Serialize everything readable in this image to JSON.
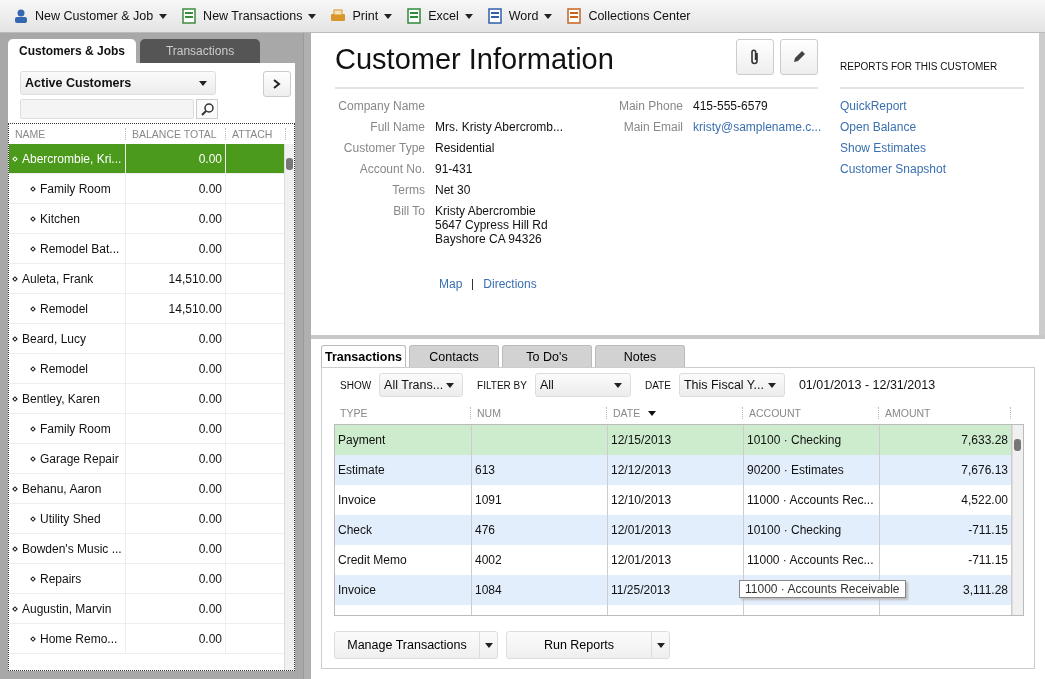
{
  "toolbar": [
    {
      "label": "New Customer & Job",
      "kind": "dropdown"
    },
    {
      "label": "New Transactions",
      "kind": "dropdown"
    },
    {
      "label": "Print",
      "kind": "dropdown"
    },
    {
      "label": "Excel",
      "kind": "dropdown"
    },
    {
      "label": "Word",
      "kind": "dropdown"
    },
    {
      "label": "Collections Center",
      "kind": "button"
    }
  ],
  "center": {
    "tabs": [
      {
        "label": "Customers & Jobs",
        "selected": true
      },
      {
        "label": "Transactions",
        "selected": false
      }
    ],
    "view_filter": "Active Customers",
    "columns": [
      "NAME",
      "BALANCE TOTAL",
      "ATTACH"
    ],
    "customers": [
      {
        "name": "Abercrombie, Kri...",
        "balance": "0.00",
        "selected": true,
        "children": [
          {
            "name": "Family Room",
            "balance": "0.00",
            "selected": false
          },
          {
            "name": "Kitchen",
            "balance": "0.00",
            "selected": false
          },
          {
            "name": "Remodel Bat...",
            "balance": "0.00",
            "selected": false
          }
        ]
      },
      {
        "name": "Auleta, Frank",
        "balance": "14,510.00",
        "selected": false,
        "children": [
          {
            "name": "Remodel",
            "balance": "14,510.00",
            "selected": false
          }
        ]
      },
      {
        "name": "Beard, Lucy",
        "balance": "0.00",
        "selected": false,
        "children": [
          {
            "name": "Remodel",
            "balance": "0.00",
            "selected": false
          }
        ]
      },
      {
        "name": "Bentley, Karen",
        "balance": "0.00",
        "selected": false,
        "children": [
          {
            "name": "Family Room",
            "balance": "0.00",
            "selected": false
          },
          {
            "name": "Garage Repair",
            "balance": "0.00",
            "selected": false
          }
        ]
      },
      {
        "name": "Behanu, Aaron",
        "balance": "0.00",
        "selected": false,
        "children": [
          {
            "name": "Utility Shed",
            "balance": "0.00",
            "selected": false
          }
        ]
      },
      {
        "name": "Bowden's Music ...",
        "balance": "0.00",
        "selected": false,
        "children": [
          {
            "name": "Repairs",
            "balance": "0.00",
            "selected": false
          }
        ]
      },
      {
        "name": "Augustin, Marvin",
        "balance": "0.00",
        "selected": false,
        "children": [
          {
            "name": "Home Remo...",
            "balance": "0.00",
            "selected": false
          }
        ]
      }
    ]
  },
  "customer_info": {
    "title": "Customer Information",
    "fields_left": [
      {
        "label": "Company Name"
      },
      {
        "label": "Full Name",
        "value": [
          "Mrs. Kristy Abercromb..."
        ]
      },
      {
        "label": "Customer Type",
        "value": [
          "Residential"
        ]
      },
      {
        "label": "Account No.",
        "value": [
          "91-431"
        ]
      },
      {
        "label": "Terms",
        "value": [
          "Net 30"
        ]
      },
      {
        "label": "Bill To",
        "value": [
          "Kristy Abercrombie",
          "5647 Cypress Hill Rd",
          "Bayshore CA 94326"
        ]
      }
    ],
    "fields_right": [
      {
        "label": "Main Phone",
        "value": "415-555-6579",
        "kind": "text"
      },
      {
        "label": "Main Email",
        "value": "kristy@samplename.c...",
        "kind": "link"
      }
    ],
    "map_links": [
      "Map",
      "Directions"
    ],
    "reports_heading": "REPORTS FOR THIS CUSTOMER",
    "reports": [
      "QuickReport",
      "Open Balance",
      "Show Estimates",
      "Customer Snapshot"
    ]
  },
  "details": {
    "tabs": [
      {
        "label": "Transactions",
        "selected": true
      },
      {
        "label": "Contacts",
        "selected": false
      },
      {
        "label": "To Do's",
        "selected": false
      },
      {
        "label": "Notes",
        "selected": false
      }
    ],
    "filters": [
      {
        "label": "SHOW",
        "value": "All Trans..."
      },
      {
        "label": "FILTER BY",
        "value": "All"
      },
      {
        "label": "DATE",
        "value": "This Fiscal Y..."
      }
    ],
    "date_range": "01/01/2013 - 12/31/2013",
    "columns": [
      {
        "label": "TYPE",
        "sorted": false
      },
      {
        "label": "NUM",
        "sorted": false
      },
      {
        "label": "DATE",
        "sorted": true
      },
      {
        "label": "ACCOUNT",
        "sorted": false
      },
      {
        "label": "AMOUNT",
        "sorted": false
      }
    ],
    "rows": [
      {
        "type": "Payment",
        "num": "",
        "date": "12/15/2013",
        "account": "10100 · Checking",
        "amount": "7,633.28",
        "selected": true
      },
      {
        "type": "Estimate",
        "num": "613",
        "date": "12/12/2013",
        "account": "90200 · Estimates",
        "amount": "7,676.13",
        "selected": false
      },
      {
        "type": "Invoice",
        "num": "1091",
        "date": "12/10/2013",
        "account": "11000 · Accounts Rec...",
        "amount": "4,522.00",
        "selected": false
      },
      {
        "type": "Check",
        "num": "476",
        "date": "12/01/2013",
        "account": "10100 · Checking",
        "amount": "-711.15",
        "selected": false
      },
      {
        "type": "Credit Memo",
        "num": "4002",
        "date": "12/01/2013",
        "account": "11000 · Accounts Rec...",
        "amount": "-711.15",
        "selected": false
      },
      {
        "type": "Invoice",
        "num": "1084",
        "date": "11/25/2013",
        "account": "",
        "amount": "3,111.28",
        "selected": false
      }
    ],
    "tooltip": "11000 · Accounts Receivable",
    "buttons": [
      "Manage Transactions",
      "Run Reports"
    ]
  }
}
